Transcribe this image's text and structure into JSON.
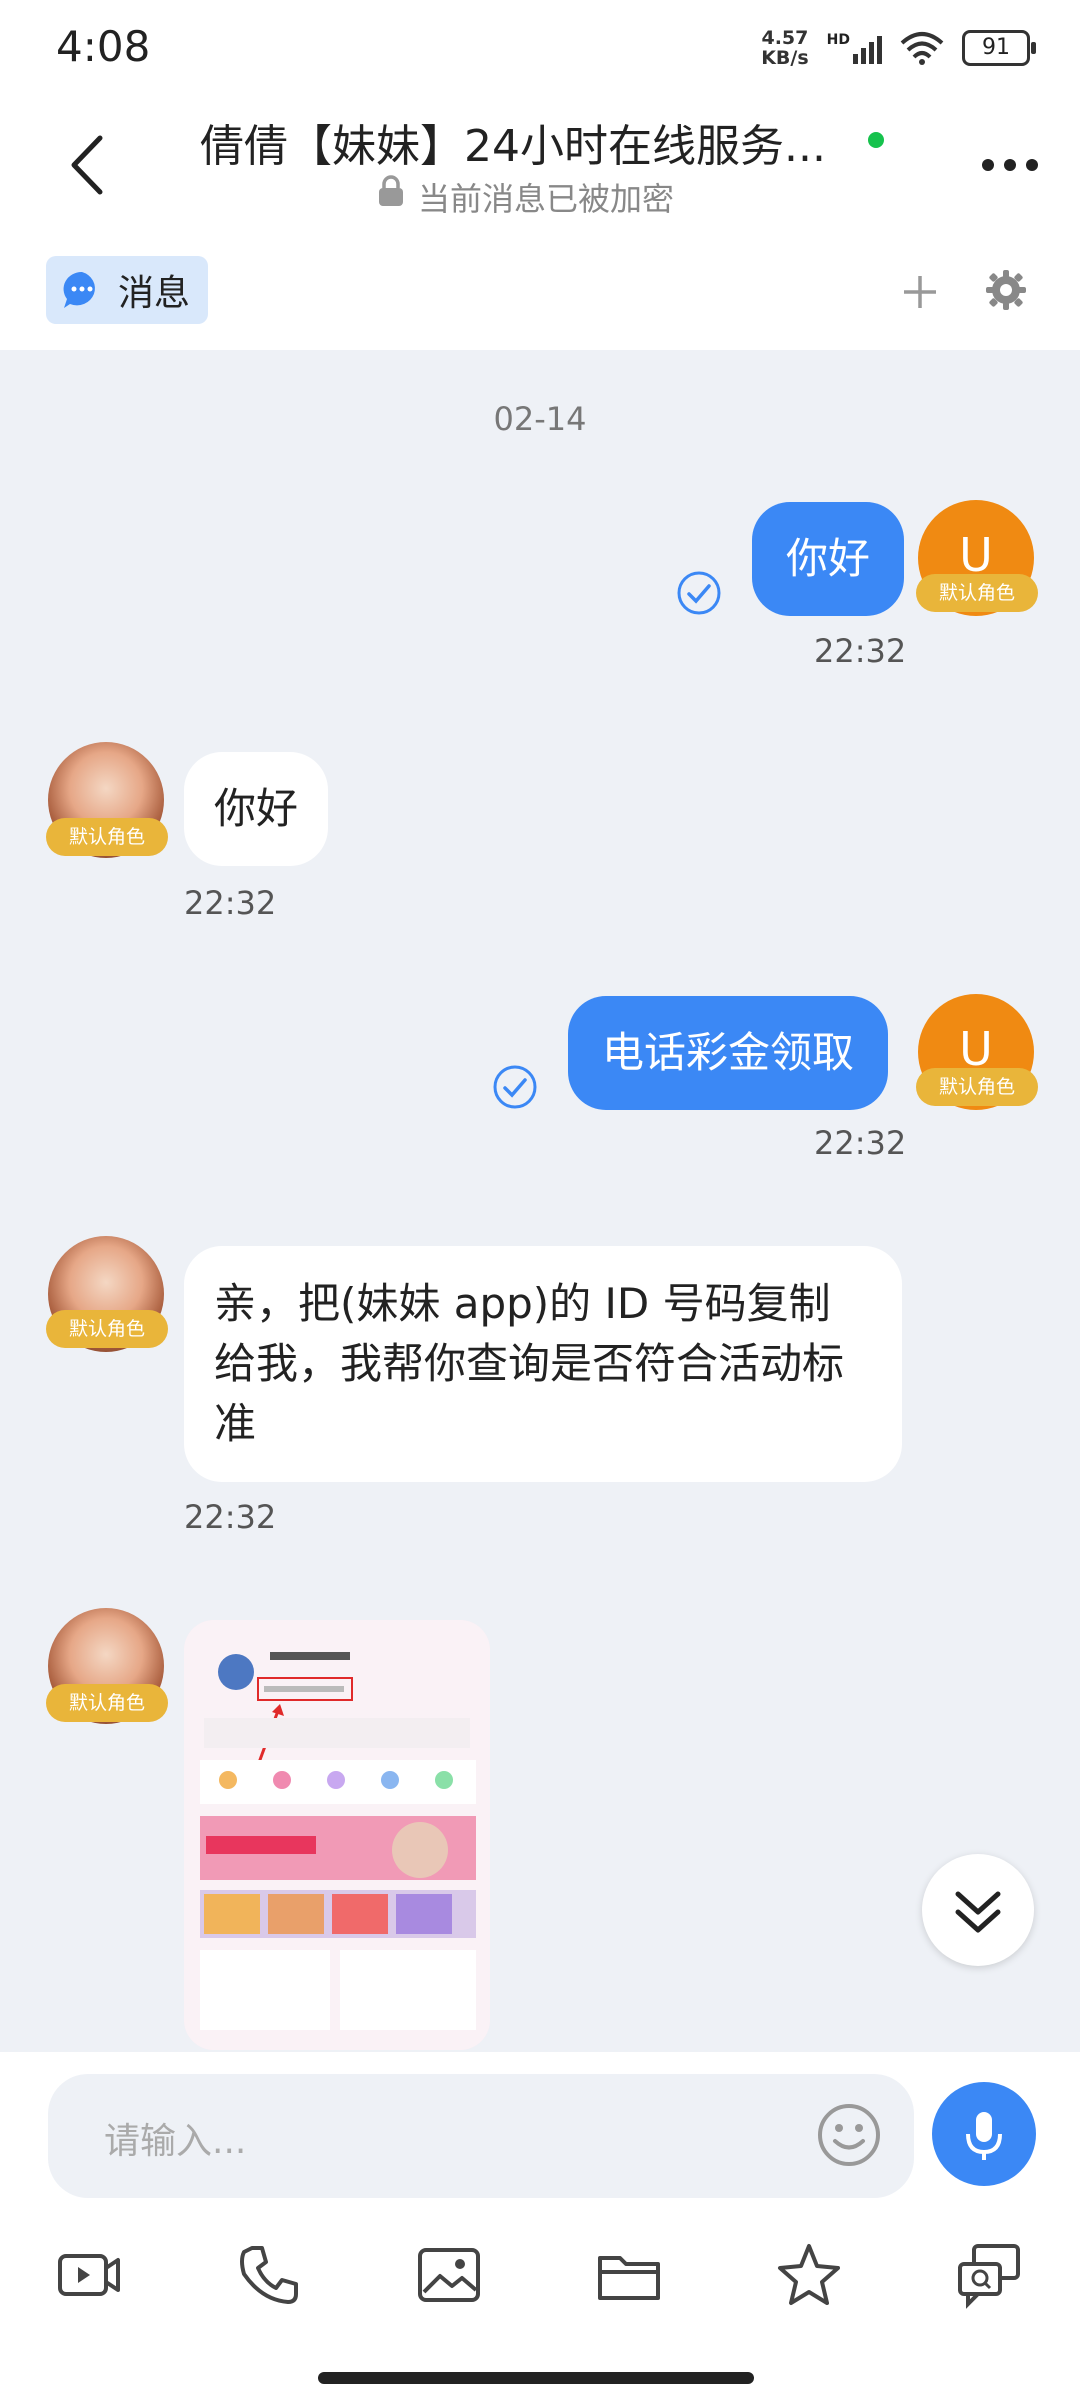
{
  "status": {
    "time": "4:08",
    "net_speed_value": "4.57",
    "net_speed_unit": "KB/s",
    "hd_label": "HD",
    "battery": "91"
  },
  "header": {
    "title": "倩倩【妹妹】24小时在线服务...",
    "subtitle": "当前消息已被加密"
  },
  "tabs": {
    "messages_label": "消息"
  },
  "chat": {
    "date": "02-14",
    "role_tag": "默认角色",
    "self_initial": "U",
    "messages": [
      {
        "text": "你好",
        "time": "22:32"
      },
      {
        "text": "你好",
        "time": "22:32"
      },
      {
        "text": "电话彩金领取",
        "time": "22:32"
      },
      {
        "text": "亲，把(妹妹 app)的 ID 号码复制给我，我帮你查询是否符合活动标准",
        "time": "22:32"
      }
    ]
  },
  "input": {
    "placeholder": "请输入..."
  },
  "colors": {
    "accent": "#3b88f5",
    "online": "#16c24d",
    "avatar_orange": "#f08a12",
    "role_tag": "#e9b53a"
  }
}
